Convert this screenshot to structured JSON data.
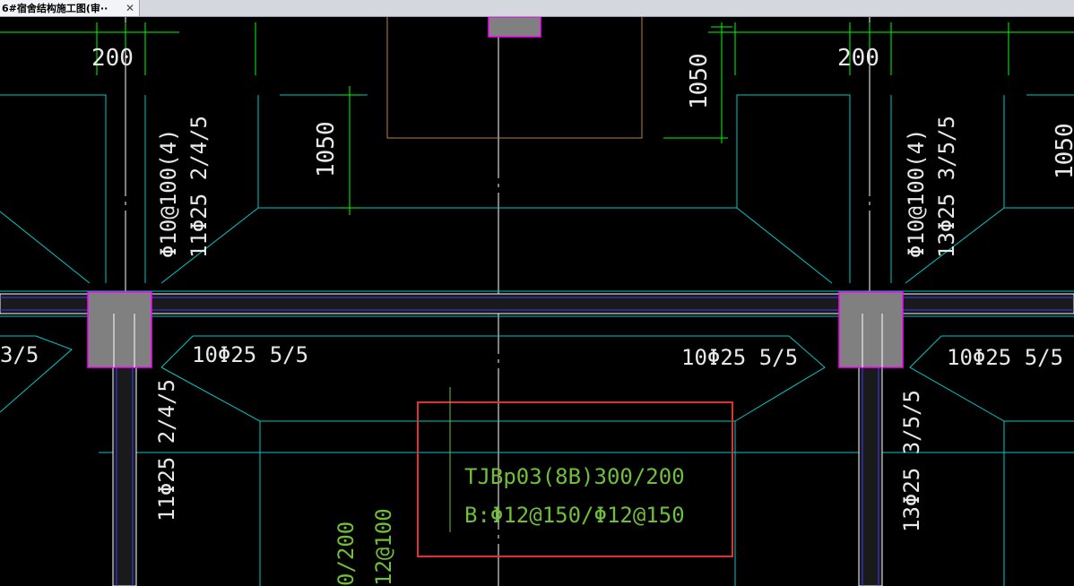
{
  "tab": {
    "title": "6#宿舍结构施工图(审··",
    "close_glyph": "✕"
  },
  "colors": {
    "background": "#000000",
    "beam_outline": "#00c8c8",
    "dimension": "#00ff00",
    "column_fill": "#808080",
    "column_border": "#ff00ff",
    "highlight_box": "#e03030",
    "text_white": "#e8e8e8",
    "text_green": "#6fbf3a",
    "axis": "#ffffff",
    "wall": "#c08040",
    "blue": "#3a3aff"
  },
  "drawing": {
    "dim_200_left": "200",
    "dim_200_right": "200",
    "dim_1050_top": "1050",
    "dim_1050_mid": "1050",
    "dim_1050_right": "1050",
    "left_stirrup": "Φ10@100(4)",
    "left_rebar_top": "11Φ25 2/4/5",
    "right_stirrup": "Φ10@100(4)",
    "right_rebar_top": "13Φ25 3/5/5",
    "left_edge_label": "3/5",
    "bottom_left_label": "10Φ25 5/5",
    "bottom_mid_label": "10Φ25 5/5",
    "bottom_right_label": "10Φ25 5/5",
    "left_rebar_bottom": "11Φ25 2/4/5",
    "right_rebar_bottom": "13Φ25 3/5/5",
    "beam_label_line1": "TJBp03(8B)300/200",
    "beam_label_line2": "B:Φ12@150/Φ12@150",
    "bottom_vertical_1": "0/200",
    "bottom_vertical_2": "12@100"
  }
}
